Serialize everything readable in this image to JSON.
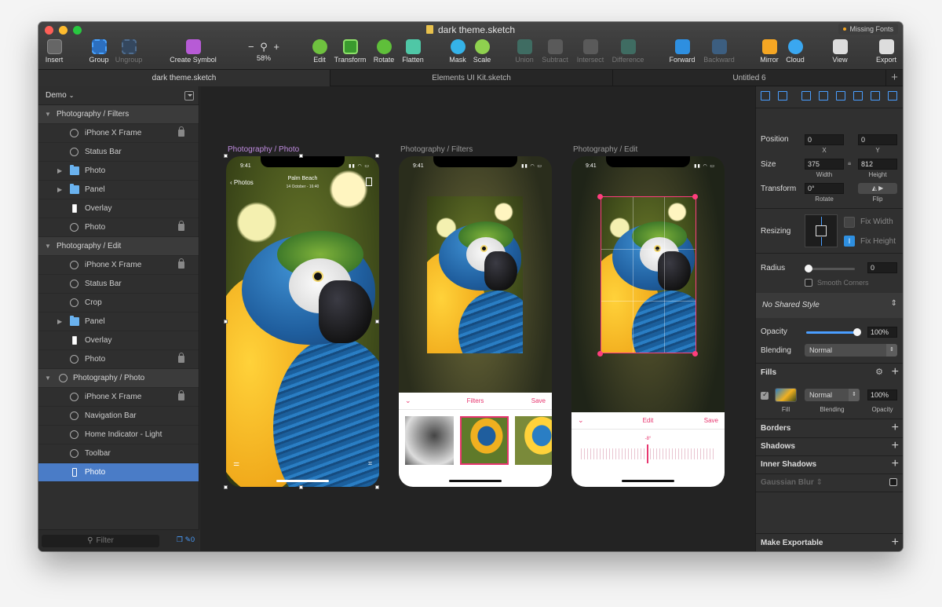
{
  "window": {
    "title": "dark theme.sketch",
    "missing_fonts": "Missing Fonts"
  },
  "toolbar": {
    "insert": "Insert",
    "group": "Group",
    "ungroup": "Ungroup",
    "create_symbol": "Create Symbol",
    "zoom_minus": "−",
    "zoom_plus": "+",
    "zoom": "58%",
    "edit": "Edit",
    "transform": "Transform",
    "rotate": "Rotate",
    "flatten": "Flatten",
    "mask": "Mask",
    "scale": "Scale",
    "union": "Union",
    "subtract": "Subtract",
    "intersect": "Intersect",
    "difference": "Difference",
    "forward": "Forward",
    "backward": "Backward",
    "mirror": "Mirror",
    "cloud": "Cloud",
    "view": "View",
    "export": "Export"
  },
  "tabs": [
    {
      "label": "dark theme.sketch"
    },
    {
      "label": "Elements UI Kit.sketch"
    },
    {
      "label": "Untitled 6"
    }
  ],
  "tab_add": "+",
  "sidebar": {
    "page": "Demo",
    "filter_placeholder": "Filter",
    "footer_count": "0",
    "layers": [
      {
        "label": "Photography / Filters"
      },
      {
        "label": "iPhone X Frame"
      },
      {
        "label": "Status Bar"
      },
      {
        "label": "Photo"
      },
      {
        "label": "Panel"
      },
      {
        "label": "Overlay"
      },
      {
        "label": "Photo"
      },
      {
        "label": "Photography / Edit"
      },
      {
        "label": "iPhone X Frame"
      },
      {
        "label": "Status Bar"
      },
      {
        "label": "Crop"
      },
      {
        "label": "Panel"
      },
      {
        "label": "Overlay"
      },
      {
        "label": "Photo"
      },
      {
        "label": "Photography / Photo"
      },
      {
        "label": "iPhone X Frame"
      },
      {
        "label": "Navigation Bar"
      },
      {
        "label": "Home Indicator - Light"
      },
      {
        "label": "Toolbar"
      },
      {
        "label": "Photo"
      }
    ]
  },
  "canvas": {
    "artboards": [
      {
        "label": "Photography / Photo"
      },
      {
        "label": "Photography / Filters"
      },
      {
        "label": "Photography / Edit"
      }
    ],
    "status_time": "9:41",
    "nav_back": "Photos",
    "nav_title": "Palm Beach",
    "nav_subtitle": "14 October - 16:40",
    "filters_title": "Filters",
    "edit_title": "Edit",
    "save": "Save",
    "edit_value": "-8°"
  },
  "inspector": {
    "position_label": "Position",
    "x": "0",
    "y": "0",
    "x_label": "X",
    "y_label": "Y",
    "size_label": "Size",
    "width": "375",
    "height": "812",
    "width_label": "Width",
    "height_label": "Height",
    "transform_label": "Transform",
    "rotate": "0°",
    "rotate_label": "Rotate",
    "flip_label": "Flip",
    "resizing_label": "Resizing",
    "fix_width": "Fix Width",
    "fix_height": "Fix Height",
    "radius_label": "Radius",
    "radius": "0",
    "smooth_corners": "Smooth Corners",
    "shared_style": "No Shared Style",
    "opacity_label": "Opacity",
    "opacity": "100%",
    "blending_label": "Blending",
    "blending": "Normal",
    "fills_label": "Fills",
    "fill_blending": "Normal",
    "fill_opacity": "100%",
    "fill_sub": "Fill",
    "fill_blending_sub": "Blending",
    "fill_opacity_sub": "Opacity",
    "borders_label": "Borders",
    "shadows_label": "Shadows",
    "inner_shadows_label": "Inner Shadows",
    "gaussian_blur": "Gaussian Blur",
    "make_exportable": "Make Exportable"
  },
  "colors": {
    "accent": "#4a9eff",
    "selection": "#4a7cc7",
    "ios_pink": "#e7356e"
  }
}
